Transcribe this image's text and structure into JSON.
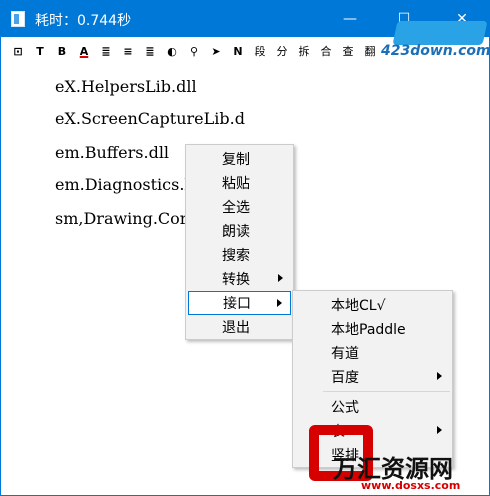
{
  "window": {
    "title": "耗时：0.744秒",
    "controls": {
      "minimize": "—",
      "maximize": "☐",
      "close": "✕"
    }
  },
  "toolbar": {
    "buttons": [
      {
        "label": "⊡",
        "name": "frame-icon"
      },
      {
        "label": "T",
        "name": "text-icon"
      },
      {
        "label": "B",
        "name": "bold-icon"
      },
      {
        "label": "A",
        "name": "font-color-icon"
      },
      {
        "label": "≣",
        "name": "align-left-icon"
      },
      {
        "label": "≡",
        "name": "align-center-icon"
      },
      {
        "label": "≣",
        "name": "align-right-icon"
      },
      {
        "label": "◐",
        "name": "palette-icon"
      },
      {
        "label": "⚲",
        "name": "search-icon"
      },
      {
        "label": "➤",
        "name": "send-icon"
      },
      {
        "label": "N",
        "name": "n-icon"
      },
      {
        "label": "段",
        "name": "segment-icon"
      },
      {
        "label": "分",
        "name": "split-icon"
      },
      {
        "label": "拆",
        "name": "break-icon"
      },
      {
        "label": "合",
        "name": "merge-icon"
      },
      {
        "label": "查",
        "name": "lookup-icon"
      },
      {
        "label": "翻",
        "name": "translate-icon"
      }
    ]
  },
  "content": {
    "lines": [
      "eX.HelpersLib.dll",
      "eX.ScreenCaptureLib.d",
      "em.Buffers.dll",
      "em.Diagnostics.l",
      "sm,Drawing.Cor"
    ]
  },
  "context_menu": {
    "items": [
      "复制",
      "粘贴",
      "全选",
      "朗读",
      "搜索",
      "转换",
      "接口",
      "退出"
    ]
  },
  "submenu": {
    "items": [
      "本地CL√",
      "本地Paddle",
      "有道",
      "百度",
      "公式",
      "表",
      "竖排"
    ]
  },
  "watermarks": {
    "top_right": "423down.com",
    "bottom_right_title": "万汇资源网",
    "bottom_right_url": "www.dosxs.com"
  },
  "colors": {
    "accent": "#0078d7",
    "menu_bg": "#f2f2f2",
    "watermark_red": "#d60000"
  }
}
